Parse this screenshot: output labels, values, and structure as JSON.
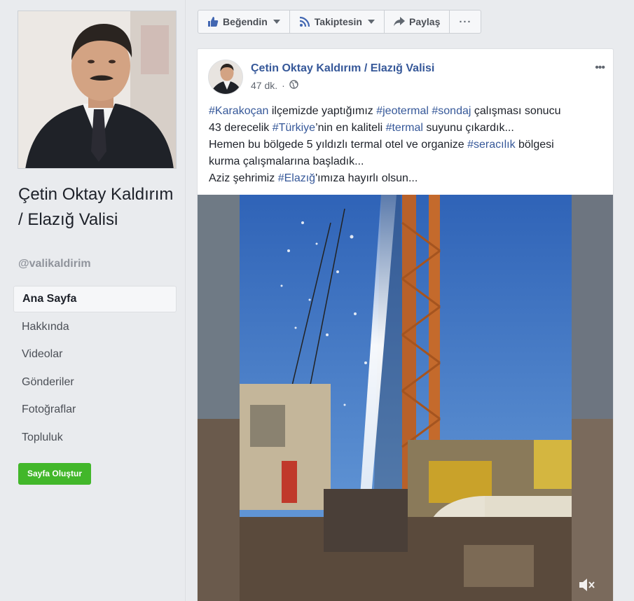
{
  "sidebar": {
    "page_name": "Çetin Oktay Kaldırım / Elazığ Valisi",
    "handle": "@valikaldirim",
    "nav_items": [
      {
        "label": "Ana Sayfa",
        "active": true
      },
      {
        "label": "Hakkında",
        "active": false
      },
      {
        "label": "Videolar",
        "active": false
      },
      {
        "label": "Gönderiler",
        "active": false
      },
      {
        "label": "Fotoğraflar",
        "active": false
      },
      {
        "label": "Topluluk",
        "active": false
      }
    ],
    "create_page_label": "Sayfa Oluştur"
  },
  "action_bar": {
    "like_label": "Beğendin",
    "follow_label": "Takiptesin",
    "share_label": "Paylaş",
    "more_label": "···"
  },
  "post": {
    "author": "Çetin Oktay Kaldırım / Elazığ Valisi",
    "time": "47 dk.",
    "options_label": "•••",
    "lines": [
      {
        "parts": [
          {
            "text": "#Karakoçan",
            "tag": true
          },
          {
            "text": " ilçemizde yaptığımız ",
            "tag": false
          },
          {
            "text": "#jeotermal",
            "tag": true
          },
          {
            "text": " ",
            "tag": false
          },
          {
            "text": "#sondaj",
            "tag": true
          },
          {
            "text": " çalışması sonucu",
            "tag": false
          }
        ]
      },
      {
        "parts": [
          {
            "text": "43 derecelik ",
            "tag": false
          },
          {
            "text": "#Türkiye",
            "tag": true
          },
          {
            "text": "’nin en kaliteli ",
            "tag": false
          },
          {
            "text": "#termal",
            "tag": true
          },
          {
            "text": " suyunu çıkardık...",
            "tag": false
          }
        ]
      },
      {
        "parts": [
          {
            "text": "Hemen bu bölgede 5 yıldızlı termal otel ve organize ",
            "tag": false
          },
          {
            "text": "#seracılık",
            "tag": true
          },
          {
            "text": " bölgesi",
            "tag": false
          }
        ]
      },
      {
        "parts": [
          {
            "text": "kurma çalışmalarına başladık...",
            "tag": false
          }
        ]
      },
      {
        "parts": [
          {
            "text": "Aziz şehrimiz ",
            "tag": false
          },
          {
            "text": "#Elazığ",
            "tag": true
          },
          {
            "text": "'ımıza hayırlı olsun...",
            "tag": false
          }
        ]
      }
    ]
  },
  "colors": {
    "link": "#365899",
    "green_button": "#42b72a",
    "background": "#e9ebee"
  },
  "icons": {
    "like": "thumbs-up-icon",
    "follow": "rss-icon",
    "share": "share-arrow-icon",
    "privacy": "globe-icon",
    "video_audio": "muted-speaker-icon"
  }
}
